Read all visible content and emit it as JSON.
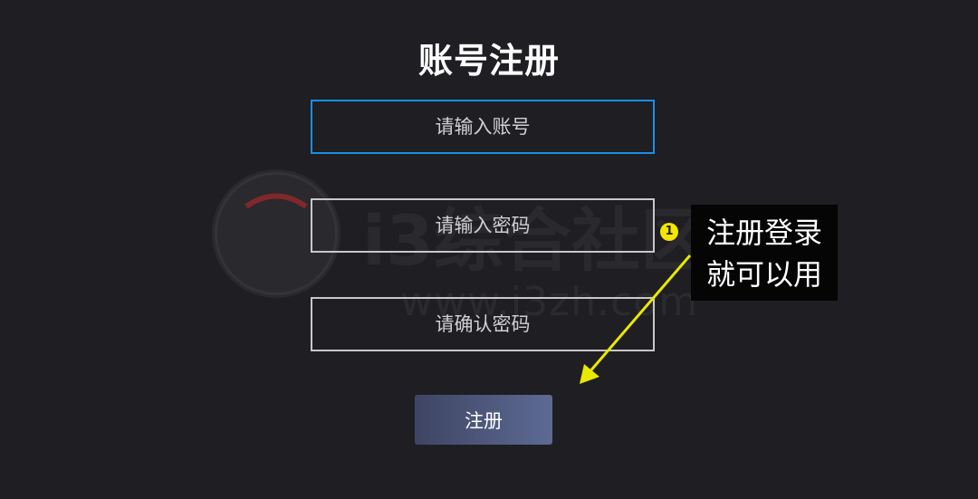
{
  "page": {
    "title": "账号注册"
  },
  "form": {
    "account_placeholder": "请输入账号",
    "password_placeholder": "请输入密码",
    "confirm_placeholder": "请确认密码",
    "register_label": "注册"
  },
  "watermark": {
    "logo_text": "i3综合社区",
    "url_text": "www.i3zh.com"
  },
  "annotation": {
    "step_number": "1",
    "line1": "注册登录",
    "line2": "就可以用"
  },
  "colors": {
    "background": "#1e1e23",
    "focus_border": "#1a8fe6",
    "button_gradient_start": "#3e4563",
    "button_gradient_end": "#5d6a94",
    "annotation_marker": "#f4e600",
    "annotation_arrow": "#e8e800"
  }
}
